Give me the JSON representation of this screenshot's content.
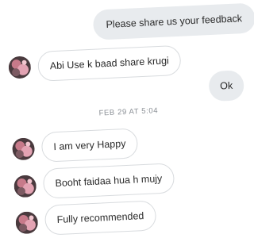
{
  "messages": [
    {
      "side": "out",
      "text": "Please share us your feedback"
    },
    {
      "side": "in",
      "text": "Abi Use k baad share krugi"
    },
    {
      "side": "out",
      "text": "Ok"
    },
    {
      "side": "in",
      "text": "I am very Happy"
    },
    {
      "side": "in",
      "text": "Booht faidaa hua h mujy"
    },
    {
      "side": "in",
      "text": "Fully recommended"
    }
  ],
  "timestamp": "FEB 29 AT 5:04",
  "colors": {
    "outgoing_bubble": "#e8ebee",
    "incoming_border": "#d8dbde",
    "timestamp_text": "#8a8f95"
  }
}
